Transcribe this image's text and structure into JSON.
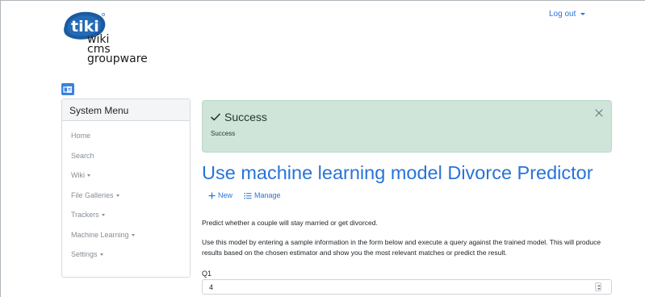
{
  "logo": {
    "line1": "wiki",
    "line2": "cms",
    "line3": "groupware",
    "badge": "tiki",
    "icon": "tiki-logo-icon"
  },
  "header": {
    "logout_label": "Log out"
  },
  "sidebar": {
    "title": "System Menu",
    "items": [
      {
        "label": "Home",
        "has_caret": false
      },
      {
        "label": "Search",
        "has_caret": false
      },
      {
        "label": "Wiki",
        "has_caret": true
      },
      {
        "label": "File Galleries",
        "has_caret": true
      },
      {
        "label": "Trackers",
        "has_caret": true
      },
      {
        "label": "Machine Learning",
        "has_caret": true
      },
      {
        "label": "Settings",
        "has_caret": true
      }
    ]
  },
  "alert": {
    "title": "Success",
    "body": "Success",
    "color": "#cfe5da"
  },
  "page": {
    "title": "Use machine learning model Divorce Predictor",
    "actions": {
      "new_label": "New",
      "manage_label": "Manage"
    },
    "description": "Predict whether a couple will stay married or get divorced.",
    "instructions": "Use this model by entering a sample information in the form below and execute a query against the trained model. This will produce results based on the chosen estimator and show you the most relevant matches or predict the result."
  },
  "form": {
    "q1_label": "Q1",
    "q1_value": "4"
  },
  "colors": {
    "accent": "#2873d8",
    "success_bg": "#cfe5da"
  }
}
